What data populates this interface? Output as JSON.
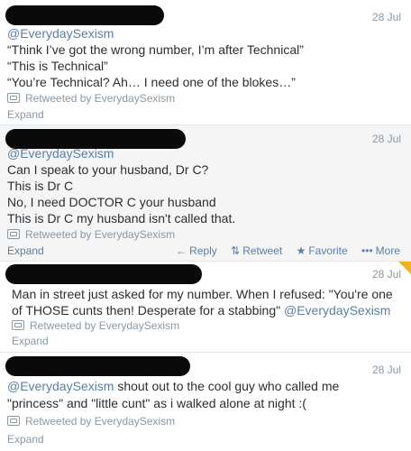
{
  "tweets": [
    {
      "date": "28 Jul",
      "lines": [
        "@EverydaySexism",
        "“Think I’ve got the wrong number, I’m after Technical”",
        "“This is Technical”",
        "“You’re Technical? Ah… I need one of the blokes…”"
      ],
      "retweeted": "Retweeted by EverydaySexism",
      "expand": "Expand"
    },
    {
      "date": "28 Jul",
      "lines": [
        "@EverydaySexism",
        "Can I speak to your husband, Dr C?",
        "This is Dr C",
        "No, I need DOCTOR C your husband",
        "This is Dr C my husband isn't called that."
      ],
      "retweeted": "Retweeted by EverydaySexism",
      "expand": "Expand",
      "actions": {
        "reply": "Reply",
        "retweet": "Retweet",
        "favorite": "Favorite",
        "more": "More"
      }
    },
    {
      "date": "28 Jul",
      "lines": [
        "Man in street just asked for my number. When I refused: \"You're one",
        "of THOSE cunts then! Desperate for a stabbing\""
      ],
      "handle": "@EverydaySexism",
      "retweeted": "Retweeted by EverydaySexism",
      "expand": "Expand"
    },
    {
      "date": "28 Jul",
      "handle": "@EverydaySexism",
      "lines": [
        "shout out to the cool guy who called me",
        "\"princess\" and \"little cunt\" as i walked alone at night :("
      ],
      "retweeted": "Retweeted by EverydaySexism",
      "expand": "Expand"
    }
  ],
  "colors": {
    "link": "#5a7fa6",
    "muted": "#8899a6",
    "favorite_corner": "#f2b318"
  }
}
